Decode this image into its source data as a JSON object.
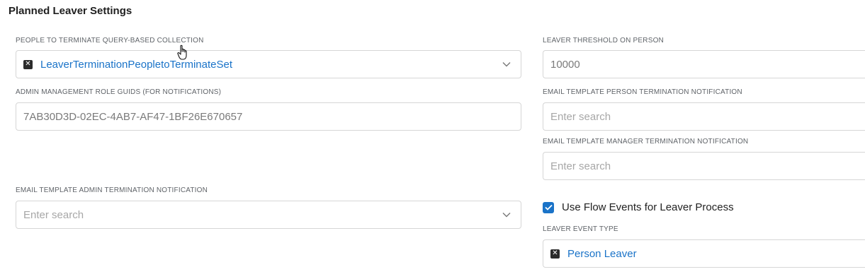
{
  "section": {
    "title": "Planned Leaver Settings"
  },
  "people_to_terminate": {
    "label": "PEOPLE TO TERMINATE QUERY-BASED COLLECTION",
    "selected": "LeaverTerminationPeopletoTerminateSet"
  },
  "leaver_threshold": {
    "label": "LEAVER THRESHOLD ON PERSON",
    "value": "10000"
  },
  "admin_role_guids": {
    "label": "ADMIN MANAGEMENT ROLE GUIDS (FOR NOTIFICATIONS)",
    "value": "7AB30D3D-02EC-4AB7-AF47-1BF26E670657"
  },
  "email_person_termination": {
    "label": "EMAIL TEMPLATE PERSON TERMINATION NOTIFICATION",
    "placeholder": "Enter search"
  },
  "email_manager_termination": {
    "label": "EMAIL TEMPLATE MANAGER TERMINATION NOTIFICATION",
    "placeholder": "Enter search"
  },
  "email_admin_termination": {
    "label": "EMAIL TEMPLATE ADMIN TERMINATION NOTIFICATION",
    "placeholder": "Enter search"
  },
  "use_flow_events": {
    "label": "Use Flow Events for Leaver Process",
    "checked": true
  },
  "leaver_event_type": {
    "label": "LEAVER EVENT TYPE",
    "selected": "Person Leaver"
  },
  "icons": {
    "remove": "close-icon",
    "dropdown": "chevron-down-icon",
    "check": "checkmark-icon"
  },
  "colors": {
    "accent": "#1a73c8",
    "chip_close": "#2b2b2b",
    "border": "#d6d6d6"
  }
}
